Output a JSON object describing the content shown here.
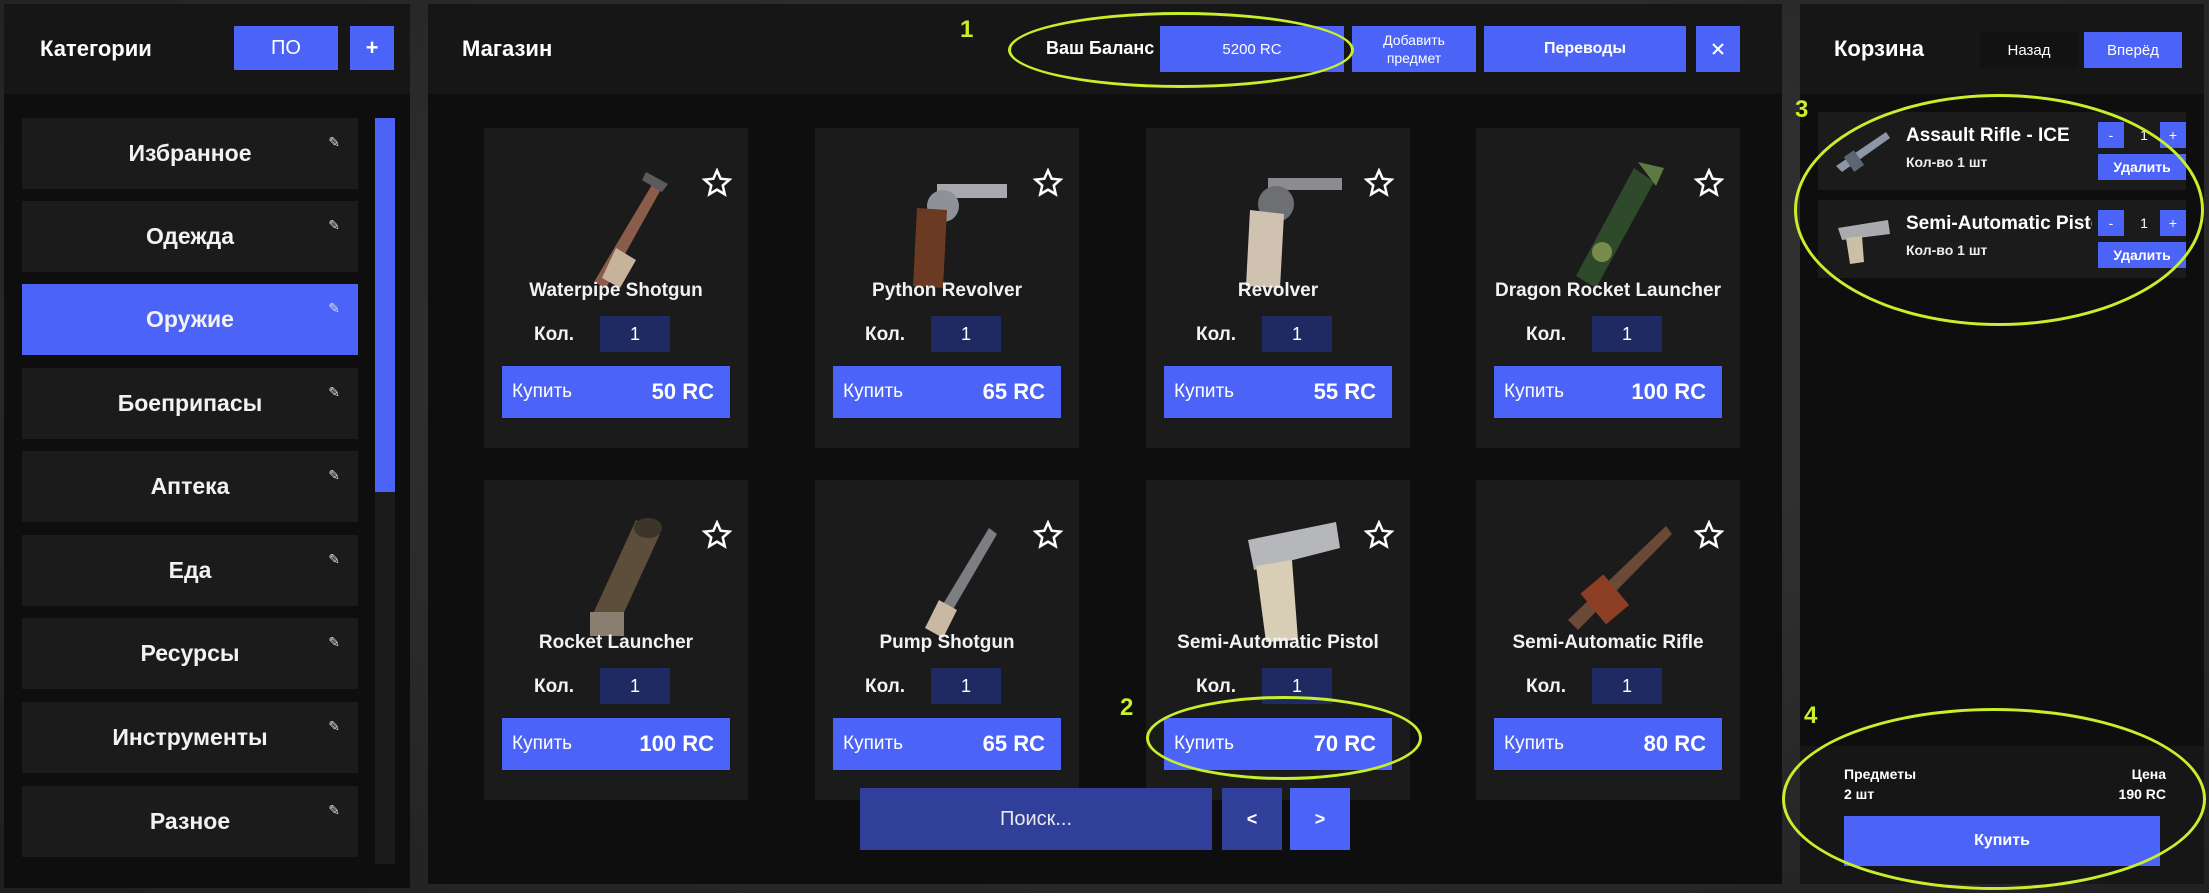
{
  "colors": {
    "accent": "#4b63f7",
    "qty_box": "#202a62",
    "panel": "#0e0e0f",
    "card": "#1b1b1c",
    "annotation": "#c9f02a"
  },
  "categories": {
    "title": "Категории",
    "po_button": "ПО",
    "add_button": "+",
    "items": [
      {
        "label": "Избранное",
        "icon": "pencil-icon"
      },
      {
        "label": "Одежда",
        "icon": "pencil-icon"
      },
      {
        "label": "Оружие",
        "icon": "pencil-icon",
        "active": true
      },
      {
        "label": "Боеприпасы",
        "icon": "pencil-icon"
      },
      {
        "label": "Аптека",
        "icon": "pencil-icon"
      },
      {
        "label": "Еда",
        "icon": "pencil-icon"
      },
      {
        "label": "Ресурсы",
        "icon": "pencil-icon"
      },
      {
        "label": "Инструменты",
        "icon": "pencil-icon"
      },
      {
        "label": "Разное",
        "icon": "pencil-icon"
      }
    ]
  },
  "shop": {
    "title": "Магазин",
    "balance_label": "Ваш Баланс",
    "balance_value": "5200 RC",
    "add_item_button": "Добавить предмет",
    "transfers_button": "Переводы",
    "close_icon": "close-icon",
    "qty_label": "Кол.",
    "buy_label": "Купить",
    "items": [
      {
        "name": "Waterpipe Shotgun",
        "qty": "1",
        "price": "50 RC",
        "icon": "shotgun-icon"
      },
      {
        "name": "Python Revolver",
        "qty": "1",
        "price": "65 RC",
        "icon": "revolver-icon"
      },
      {
        "name": "Revolver",
        "qty": "1",
        "price": "55 RC",
        "icon": "revolver-icon"
      },
      {
        "name": "Dragon Rocket Launcher",
        "qty": "1",
        "price": "100 RC",
        "icon": "rocket-launcher-icon"
      },
      {
        "name": "Rocket Launcher",
        "qty": "1",
        "price": "100 RC",
        "icon": "rocket-launcher-icon"
      },
      {
        "name": "Pump Shotgun",
        "qty": "1",
        "price": "65 RC",
        "icon": "shotgun-icon"
      },
      {
        "name": "Semi-Automatic Pistol",
        "qty": "1",
        "price": "70 RC",
        "icon": "pistol-icon"
      },
      {
        "name": "Semi-Automatic Rifle",
        "qty": "1",
        "price": "80 RC",
        "icon": "rifle-icon"
      }
    ],
    "search_placeholder": "Поиск...",
    "prev_label": "<",
    "next_label": ">"
  },
  "cart": {
    "title": "Корзина",
    "back_button": "Назад",
    "forward_button": "Вперёд",
    "items": [
      {
        "name": "Assault Rifle - ICE",
        "qty_text": "Кол-во 1 шт",
        "count": "1",
        "minus": "-",
        "plus": "+",
        "delete_label": "Удалить",
        "icon": "assault-rifle-icon"
      },
      {
        "name": "Semi-Automatic Pistol",
        "qty_text": "Кол-во 1 шт",
        "count": "1",
        "minus": "-",
        "plus": "+",
        "delete_label": "Удалить",
        "icon": "pistol-icon"
      }
    ],
    "summary": {
      "items_label": "Предметы",
      "items_value": "2 шт",
      "price_label": "Цена",
      "price_value": "190 RC",
      "buy_button": "Купить"
    }
  },
  "annotations": [
    "1",
    "2",
    "3",
    "4"
  ]
}
